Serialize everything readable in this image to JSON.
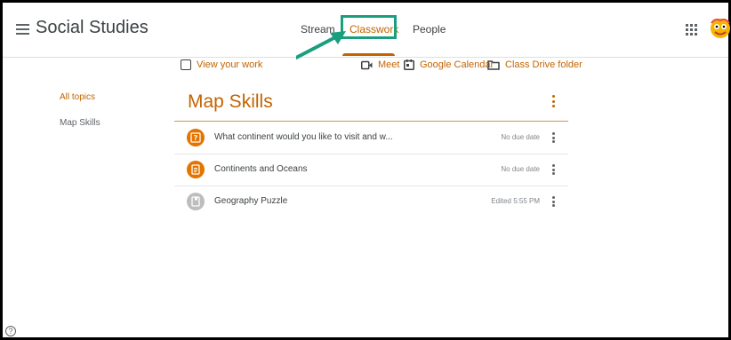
{
  "header": {
    "class_title": "Social Studies",
    "tabs": [
      {
        "label": "Stream"
      },
      {
        "label": "Classwork"
      },
      {
        "label": "People"
      }
    ]
  },
  "toolbar": {
    "view_work": "View your work",
    "meet": "Meet",
    "calendar": "Google Calendar",
    "drive": "Class Drive folder"
  },
  "sidebar": {
    "items": [
      {
        "label": "All topics"
      },
      {
        "label": "Map Skills"
      }
    ]
  },
  "topic": {
    "title": "Map Skills",
    "items": [
      {
        "title": "What continent would you like to visit and w...",
        "status": "No due date",
        "icon": "question-icon"
      },
      {
        "title": "Continents and Oceans",
        "status": "No due date",
        "icon": "assignment-icon"
      },
      {
        "title": "Geography Puzzle",
        "status": "Edited 5:55 PM",
        "icon": "material-icon"
      }
    ]
  },
  "colors": {
    "accent": "#c26401",
    "highlight": "#1a9f7e",
    "icon_orange": "#e37400",
    "icon_grey": "#bdbdbd"
  },
  "help": {
    "symbol": "?"
  }
}
